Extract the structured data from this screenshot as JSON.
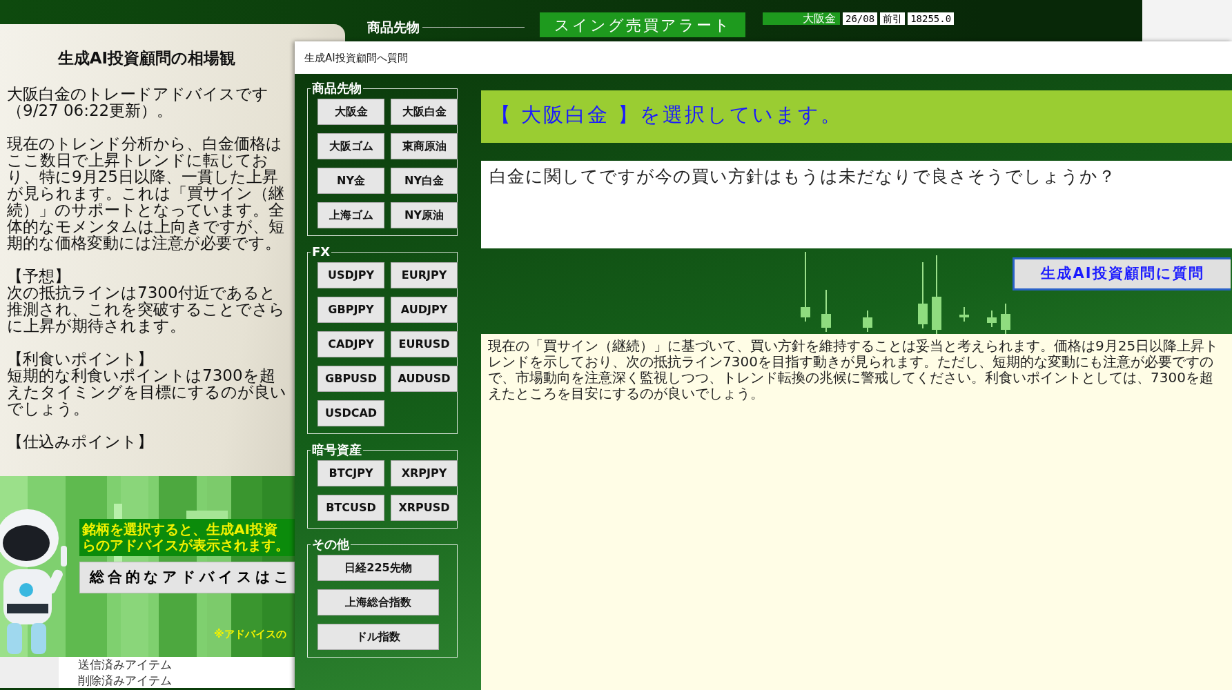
{
  "top_bar": {
    "group_label": "商品先物",
    "alert_button": "スイング売買アラート",
    "ticker": {
      "name": "大阪金",
      "month": "26/08",
      "session": "前引",
      "price": "18255.0"
    }
  },
  "market_view": {
    "title": "生成AI投資顧問の相場観",
    "paragraphs": [
      [
        "大阪白金のトレードアドバイスです（9/27 06:22更新）。"
      ],
      [
        "現在のトレンド分析から、白金価格はここ数日で上昇トレンドに転じており、特に9月25日以降、一貫した上昇が見られます。これは「買サイン（継続）」のサポートとなっています。全体的なモメンタムは上向きですが、短期的な価格変動には注意が必要です。"
      ],
      [
        "【予想】",
        "次の抵抗ラインは7300付近であると推測され、これを突破することでさらに上昇が期待されます。"
      ],
      [
        "【利食いポイント】",
        "短期的な利食いポイントは7300を超えたタイミングを目標にするのが良いでしょう。"
      ],
      [
        "【仕込みポイント】"
      ]
    ]
  },
  "banner": {
    "kind": "picture",
    "message_lines": [
      "銘柄を選択すると、生成AI投資",
      "らのアドバイスが表示されます。"
    ],
    "advice_button": "総合的なアドバイスはこ",
    "note": "※アドバイスの"
  },
  "mail_folders": [
    "送信済みアイテム",
    "削除済みアイテム"
  ],
  "dialog": {
    "title": "生成AI投資顧問へ質問",
    "groups": [
      {
        "label": "商品先物",
        "wide": false,
        "buttons": [
          "大阪金",
          "大阪白金",
          "大阪ゴム",
          "東商原油",
          "NY金",
          "NY白金",
          "上海ゴム",
          "NY原油"
        ]
      },
      {
        "label": "FX",
        "wide": false,
        "buttons": [
          "USDJPY",
          "EURJPY",
          "GBPJPY",
          "AUDJPY",
          "CADJPY",
          "EURUSD",
          "GBPUSD",
          "AUDUSD",
          "USDCAD"
        ]
      },
      {
        "label": "暗号資産",
        "wide": false,
        "buttons": [
          "BTCJPY",
          "XRPJPY",
          "BTCUSD",
          "XRPUSD"
        ]
      },
      {
        "label": "その他",
        "wide": true,
        "buttons": [
          "日経225先物",
          "上海総合指数",
          "ドル指数"
        ]
      }
    ],
    "selection_banner": "【 大阪白金 】を選択しています。",
    "question": "白金に関してですが今の買い方針はもうは未だなりで良さそうでしょうか？",
    "ask_button": "生成AI投資顧問に質問",
    "answer": "現在の「買サイン（継続）」に基づいて、買い方針を維持することは妥当と考えられます。価格は9月25日以降上昇トレンドを示しており、次の抵抗ライン7300を目指す動きが見られます。ただし、短期的な変動にも注意が必要ですので、市場動向を注意深く監視しつつ、トレンド転換の兆候に警戒してください。利食いポイントとしては、7300を超えたところを目安にするのが良いでしょう。"
  }
}
